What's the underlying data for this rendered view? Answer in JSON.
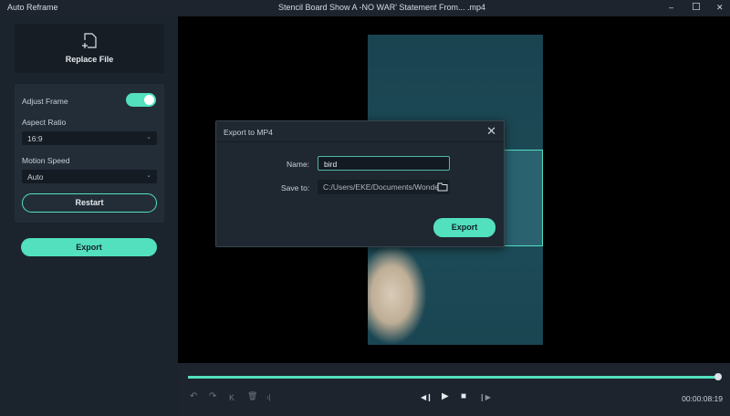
{
  "window": {
    "app_name": "Auto Reframe",
    "file_title": "Stencil Board Show A -NO WAR' Statement From... .mp4",
    "minimize": "–",
    "maximize": "☐",
    "close": "✕"
  },
  "sidebar": {
    "replace_file": "Replace File",
    "adjust_frame": "Adjust Frame",
    "adjust_frame_on": true,
    "aspect_ratio_label": "Aspect Ratio",
    "aspect_ratio_value": "16:9",
    "motion_speed_label": "Motion Speed",
    "motion_speed_value": "Auto",
    "restart": "Restart",
    "export": "Export",
    "chevron": "⌄"
  },
  "player": {
    "progress_percent": 100,
    "time": "00:00:08:19",
    "icons": {
      "undo": "↶",
      "redo": "↷",
      "prev": "K",
      "delete": "🗑",
      "next": "›|",
      "step_back": "◀❙",
      "play": "▶",
      "stop": "■",
      "step_fwd": "❙▶"
    }
  },
  "dialog": {
    "title": "Export to MP4",
    "close": "✕",
    "name_label": "Name:",
    "name_value": "bird",
    "save_label": "Save to:",
    "save_value": "C:/Users/EKE/Documents/Wonde",
    "export": "Export"
  },
  "colors": {
    "accent": "#52e0bf"
  }
}
